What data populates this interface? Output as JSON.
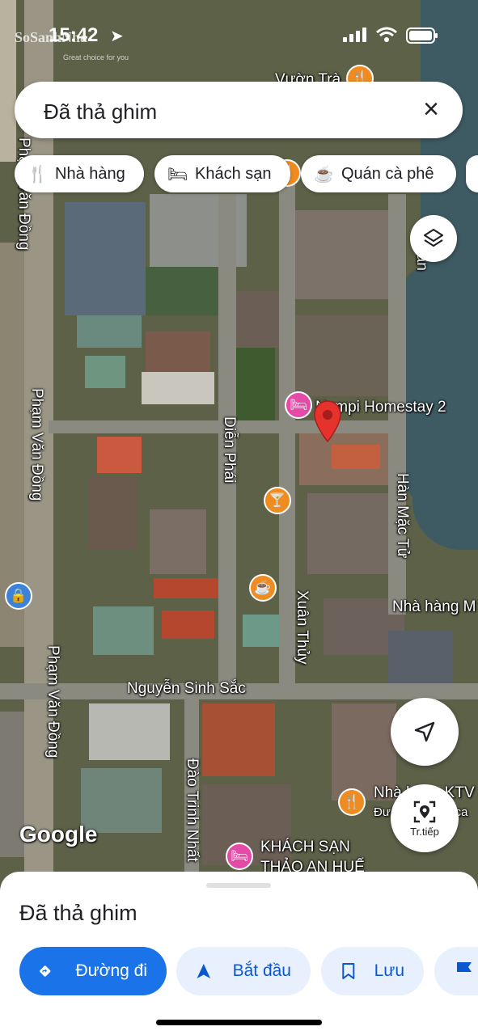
{
  "status_bar": {
    "time": "15:42",
    "watermark": "SoSanhNha",
    "watermark_sub": "Great choice for you"
  },
  "search": {
    "query": "Đã thả ghim",
    "close_icon": "close-icon"
  },
  "chips": [
    {
      "label": "Nhà hàng",
      "icon": "fork-knife-icon"
    },
    {
      "label": "Khách sạn",
      "icon": "bed-icon"
    },
    {
      "label": "Quán cà phê",
      "icon": "coffee-cup-icon"
    }
  ],
  "map": {
    "labels": {
      "street_pham_van_dong_top": "Phạm Văn Đồng",
      "street_pham_van_dong_mid": "Phạm Văn Đồng",
      "street_pham_van_dong_bottom": "Phạm Văn Đồng",
      "street_dien_phai": "Diễn Phái",
      "street_xuan_thuy": "Xuân Thủy",
      "street_han_mac_tu": "Hàn Mặc Tử",
      "street_han_top": "Hàn",
      "street_nguyen_sinh_sac": "Nguyễn Sinh Sắc",
      "street_dao_trinh_nhat": "Đào Trinh Nhất",
      "place_vuon_tra": "Vườn Trà",
      "place_homestay": "Nempi Homestay 2",
      "place_nha_hang_m": "Nhà hàng M",
      "place_nha_ktv": "Nhà hàng KTV",
      "place_nha_ktv_sub": "Đường nướng ca",
      "place_khach_san": "KHÁCH SẠN",
      "place_khach_san_2": "THẢO AN HUẾ"
    },
    "google_logo": "Google",
    "layers_icon": "layers-icon",
    "location_icon": "navigation-arrow-icon",
    "streetview_label": "Tr.tiếp"
  },
  "sheet": {
    "title": "Đã thả ghim",
    "actions": [
      {
        "label": "Đường đi",
        "icon": "directions-icon"
      },
      {
        "label": "Bắt đầu",
        "icon": "navigation-icon"
      },
      {
        "label": "Lưu",
        "icon": "bookmark-icon"
      },
      {
        "label": "",
        "icon": "flag-icon"
      }
    ]
  }
}
